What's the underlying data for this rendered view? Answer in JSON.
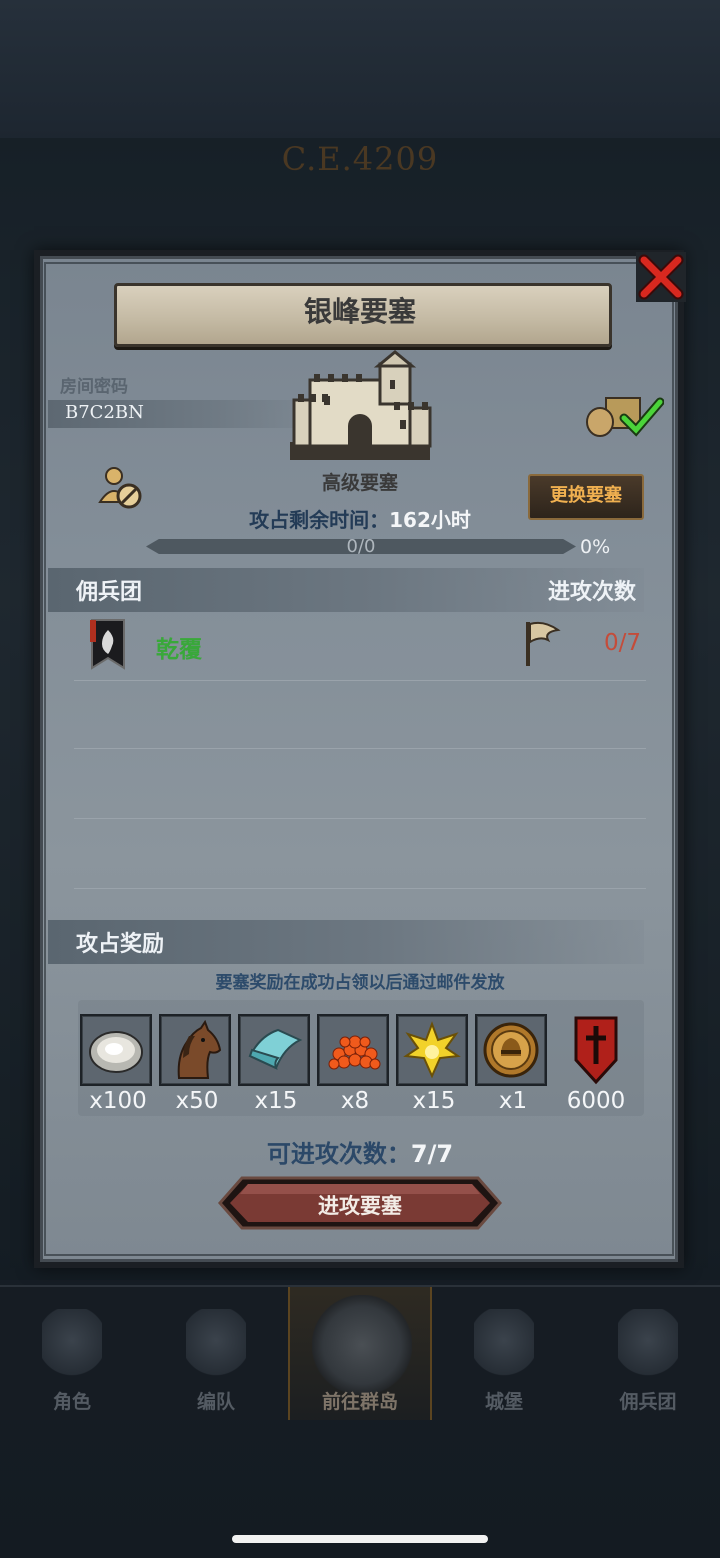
{
  "scene": {
    "era_text": "C.E.4209"
  },
  "dialog": {
    "title": "银峰要塞",
    "room_code_label": "房间密码",
    "room_code": "B7C2BN",
    "fortress_type": "高级要塞",
    "switch_button": "更换要塞",
    "remaining_time_label": "攻占剩余时间：",
    "remaining_time_value": "162小时",
    "progress_text": "0/0",
    "progress_percent": "0%",
    "progress_fraction": 0,
    "mercenary_header": "佣兵团",
    "attack_count_header": "进攻次数",
    "mercenaries": [
      {
        "name": "乾覆",
        "attacks": "0/7",
        "banner_icon": "black-flame-banner-icon",
        "flag_icon": "flag-icon"
      }
    ],
    "reward_header": "攻占奖励",
    "reward_note": "要塞奖励在成功占领以后通过邮件发放",
    "rewards": [
      {
        "icon": "oyster-icon",
        "qty": "x100"
      },
      {
        "icon": "horse-icon",
        "qty": "x50"
      },
      {
        "icon": "cloth-icon",
        "qty": "x15"
      },
      {
        "icon": "fish-roe-icon",
        "qty": "x8"
      },
      {
        "icon": "golden-emblem-icon",
        "qty": "x15"
      },
      {
        "icon": "helmet-medal-icon",
        "qty": "x1"
      },
      {
        "icon": "red-shield-icon",
        "qty": "6000"
      }
    ],
    "attempts_label": "可进攻次数：",
    "attempts_value": "7/7",
    "attack_button": "进攻要塞"
  },
  "nav": {
    "items": [
      {
        "label": "角色",
        "icon": "knight-icon"
      },
      {
        "label": "编队",
        "icon": "helmet-icon"
      },
      {
        "label": "前往群岛",
        "icon": "compass-icon",
        "active": true
      },
      {
        "label": "城堡",
        "icon": "castle-icon"
      },
      {
        "label": "佣兵团",
        "icon": "mercenary-icon"
      }
    ]
  },
  "colors": {
    "mercenary_name": "#39a83a",
    "attack_count": "#c44c3a",
    "switch_text": "#f0b050"
  }
}
